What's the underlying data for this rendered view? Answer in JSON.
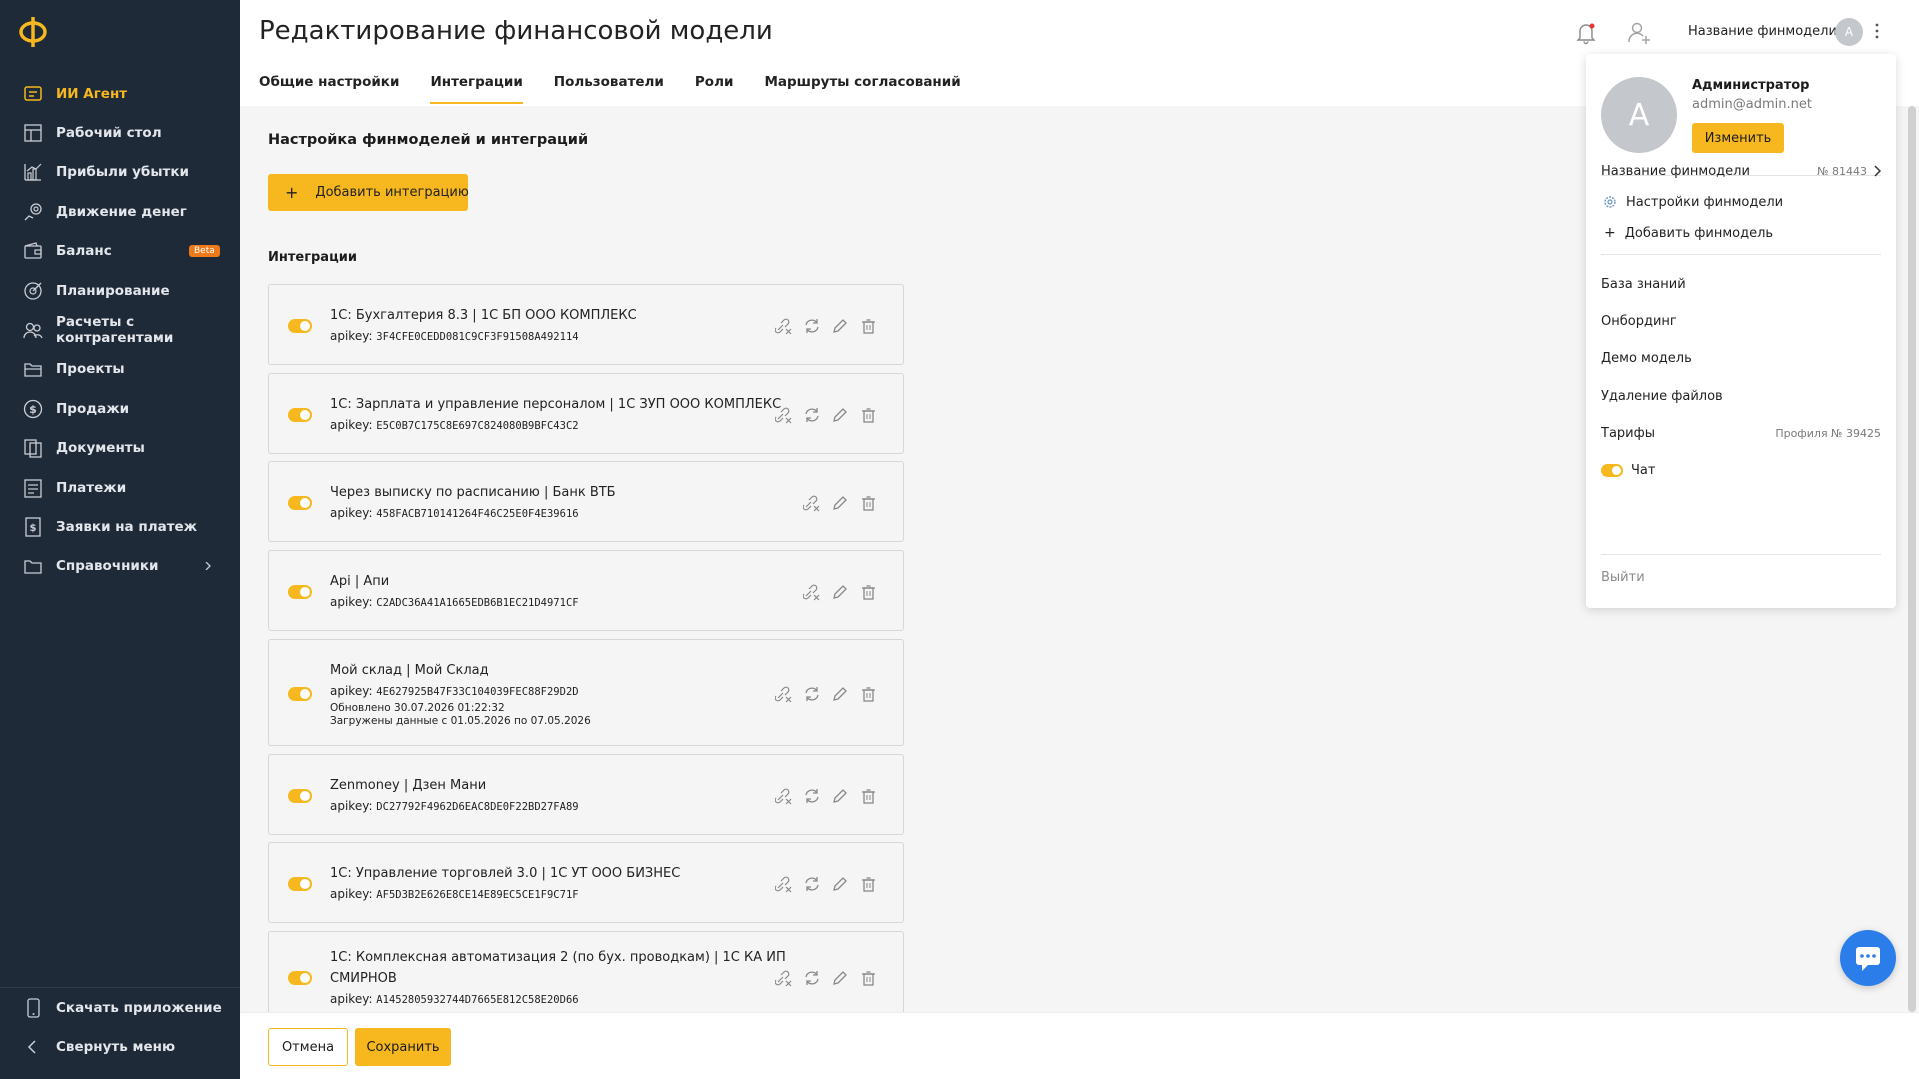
{
  "app": {
    "logo": "Ф"
  },
  "sidebar": {
    "items": [
      {
        "label": "ИИ Агент",
        "icon": "ai-agent-icon",
        "active": true
      },
      {
        "label": "Рабочий стол",
        "icon": "dashboard-icon"
      },
      {
        "label": "Прибыли убытки",
        "icon": "chart-icon"
      },
      {
        "label": "Движение денег",
        "icon": "cashflow-icon"
      },
      {
        "label": "Баланс",
        "icon": "wallet-icon",
        "badge": "Beta"
      },
      {
        "label": "Планирование",
        "icon": "target-icon"
      },
      {
        "label": "Расчеты с контрагентами",
        "icon": "users-icon"
      },
      {
        "label": "Проекты",
        "icon": "folder-icon"
      },
      {
        "label": "Продажи",
        "icon": "dollar-icon"
      },
      {
        "label": "Документы",
        "icon": "documents-icon"
      },
      {
        "label": "Платежи",
        "icon": "payments-icon"
      },
      {
        "label": "Заявки на платеж",
        "icon": "request-icon"
      },
      {
        "label": "Справочники",
        "icon": "catalog-icon",
        "chevron": true
      }
    ],
    "bottom": [
      {
        "label": "Скачать приложение",
        "icon": "phone-icon"
      },
      {
        "label": "Свернуть меню",
        "icon": "chevron-left-icon"
      }
    ]
  },
  "header": {
    "title": "Редактирование финансовой модели",
    "finmodel_name": "Название финмодели",
    "avatar_letter": "А",
    "tabs": [
      {
        "label": "Общие настройки"
      },
      {
        "label": "Интеграции",
        "active": true
      },
      {
        "label": "Пользователи"
      },
      {
        "label": "Роли"
      },
      {
        "label": "Маршруты согласований"
      }
    ]
  },
  "main": {
    "section_title": "Настройка финмоделей и интеграций",
    "add_button": "Добавить интеграцию",
    "add_plus": "+",
    "integrations_title": "Интеграции",
    "integrations": [
      {
        "title": "1С: Бухгалтерия 8.3 | 1С БП ООО КОМПЛЕКС",
        "key_label": "apikey: ",
        "key": "3F4CFE0CEDD081C9CF3F91508A492114",
        "sync": true
      },
      {
        "title": "1С: Зарплата и управление персоналом | 1С ЗУП ООО КОМПЛЕКС",
        "key_label": "apikey: ",
        "key": "E5C0B7C175C8E697C824080B9BFC43C2",
        "sync": true
      },
      {
        "title": "Через выписку по расписанию | Банк ВТБ",
        "key_label": "apikey: ",
        "key": "458FACB710141264F46C25E0F4E39616",
        "sync": false
      },
      {
        "title": "Api | Апи",
        "key_label": "apikey: ",
        "key": "C2ADC36A41A1665EDB6B1EC21D4971CF",
        "sync": false
      },
      {
        "title": "Мой склад | Мой Склад",
        "key_label": "apikey: ",
        "key": "4E627925B47F33C104039FEC88F29D2D",
        "sync": true,
        "updated": "Обновлено 30.07.2026 01:22:32",
        "loaded": "Загружены данные с 01.05.2026 по 07.05.2026"
      },
      {
        "title": "Zenmoney | Дзен Мани",
        "key_label": "apikey: ",
        "key": "DC27792F4962D6EAC8DE0F22BD27FA89",
        "sync": true
      },
      {
        "title": "1С: Управление торговлей 3.0 | 1С УТ ООО БИЗНЕС",
        "key_label": "apikey: ",
        "key": "AF5D3B2E626E8CE14E89EC5CE1F9C71F",
        "sync": true
      },
      {
        "title": "1С: Комплексная автоматизация 2 (по бух. проводкам) | 1С КА ИП",
        "title2": "СМИРНОВ",
        "key_label": "apikey: ",
        "key": "A1452805932744D7665E812C58E20D66",
        "sync": true
      }
    ]
  },
  "footer": {
    "cancel": "Отмена",
    "save": "Сохранить"
  },
  "dropdown": {
    "avatar_letter": "А",
    "name": "Администратор",
    "email": "admin@admin.net",
    "change": "Изменить",
    "finmodel": "Название финмодели",
    "finmodel_no": "№ 81443",
    "settings": "Настройки финмодели",
    "add_finmodel": "Добавить финмодель",
    "knowledge": "База знаний",
    "onboarding": "Онбординг",
    "demo": "Демо модель",
    "delete_files": "Удаление файлов",
    "tariffs": "Тарифы",
    "profile_no": "Профиля № 39425",
    "chat": "Чат",
    "logout": "Выйти"
  },
  "colors": {
    "accent": "#f6b81e",
    "sidebar_bg": "#1f2a38",
    "beta": "#ef7a1a",
    "chat": "#2b7de9"
  }
}
